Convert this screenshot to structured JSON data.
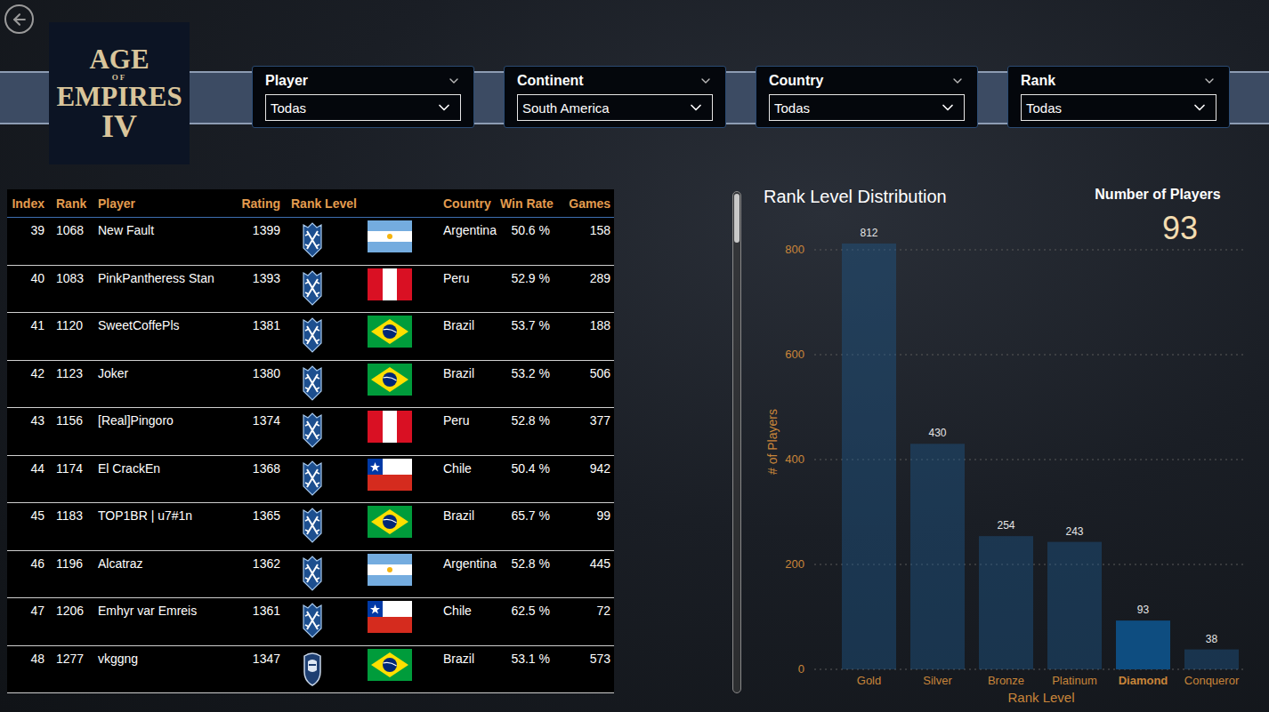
{
  "logo": {
    "lines": [
      "AGE",
      "OF",
      "EMPIRES",
      "IV"
    ]
  },
  "filters": [
    {
      "label": "Player",
      "value": "Todas"
    },
    {
      "label": "Continent",
      "value": "South America"
    },
    {
      "label": "Country",
      "value": "Todas"
    },
    {
      "label": "Rank",
      "value": "Todas"
    }
  ],
  "table": {
    "columns": [
      "Index",
      "Rank",
      "Player",
      "Rating",
      "Rank Level",
      "Country",
      "Win Rate",
      "Games"
    ],
    "rows": [
      {
        "index": "39",
        "rank": "1068",
        "player": "New Fault",
        "rating": "1399",
        "rank_level": "diamond",
        "flag": "ar",
        "country": "Argentina",
        "win_rate": "50.6 %",
        "games": "158"
      },
      {
        "index": "40",
        "rank": "1083",
        "player": "PinkPantheress Stan",
        "rating": "1393",
        "rank_level": "diamond",
        "flag": "pe",
        "country": "Peru",
        "win_rate": "52.9 %",
        "games": "289"
      },
      {
        "index": "41",
        "rank": "1120",
        "player": "SweetCoffePls",
        "rating": "1381",
        "rank_level": "diamond",
        "flag": "br",
        "country": "Brazil",
        "win_rate": "53.7 %",
        "games": "188"
      },
      {
        "index": "42",
        "rank": "1123",
        "player": "Joker",
        "rating": "1380",
        "rank_level": "diamond",
        "flag": "br",
        "country": "Brazil",
        "win_rate": "53.2 %",
        "games": "506"
      },
      {
        "index": "43",
        "rank": "1156",
        "player": "[Real]Pingoro",
        "rating": "1374",
        "rank_level": "diamond",
        "flag": "pe",
        "country": "Peru",
        "win_rate": "52.8 %",
        "games": "377"
      },
      {
        "index": "44",
        "rank": "1174",
        "player": "El CrackEn",
        "rating": "1368",
        "rank_level": "diamond",
        "flag": "cl",
        "country": "Chile",
        "win_rate": "50.4 %",
        "games": "942"
      },
      {
        "index": "45",
        "rank": "1183",
        "player": "TOP1BR | u7#1n",
        "rating": "1365",
        "rank_level": "diamond",
        "flag": "br",
        "country": "Brazil",
        "win_rate": "65.7 %",
        "games": "99"
      },
      {
        "index": "46",
        "rank": "1196",
        "player": "Alcatraz",
        "rating": "1362",
        "rank_level": "diamond",
        "flag": "ar",
        "country": "Argentina",
        "win_rate": "52.8 %",
        "games": "445"
      },
      {
        "index": "47",
        "rank": "1206",
        "player": "Emhyr var Emreis",
        "rating": "1361",
        "rank_level": "diamond",
        "flag": "cl",
        "country": "Chile",
        "win_rate": "62.5 %",
        "games": "72"
      },
      {
        "index": "48",
        "rank": "1277",
        "player": "vkggng",
        "rating": "1347",
        "rank_level": "platinum",
        "flag": "br",
        "country": "Brazil",
        "win_rate": "53.1 %",
        "games": "573"
      }
    ]
  },
  "chart": {
    "title": "Rank Level Distribution",
    "y_axis_title": "# of Players",
    "x_axis_title": "Rank Level",
    "y_ticks": [
      "0",
      "200",
      "400",
      "600",
      "800"
    ],
    "categories": [
      {
        "label": "Gold",
        "selected": false
      },
      {
        "label": "Silver",
        "selected": false
      },
      {
        "label": "Bronze",
        "selected": false
      },
      {
        "label": "Platinum",
        "selected": false
      },
      {
        "label": "Diamond",
        "selected": true
      },
      {
        "label": "Conqueror",
        "selected": false
      }
    ],
    "series": [
      {
        "values": [
          812,
          430,
          254,
          243,
          93,
          38
        ],
        "value_labels": [
          "812",
          "430",
          "254",
          "243",
          "93",
          "38"
        ]
      }
    ]
  },
  "card": {
    "title": "Number of Players",
    "value": "93"
  }
}
